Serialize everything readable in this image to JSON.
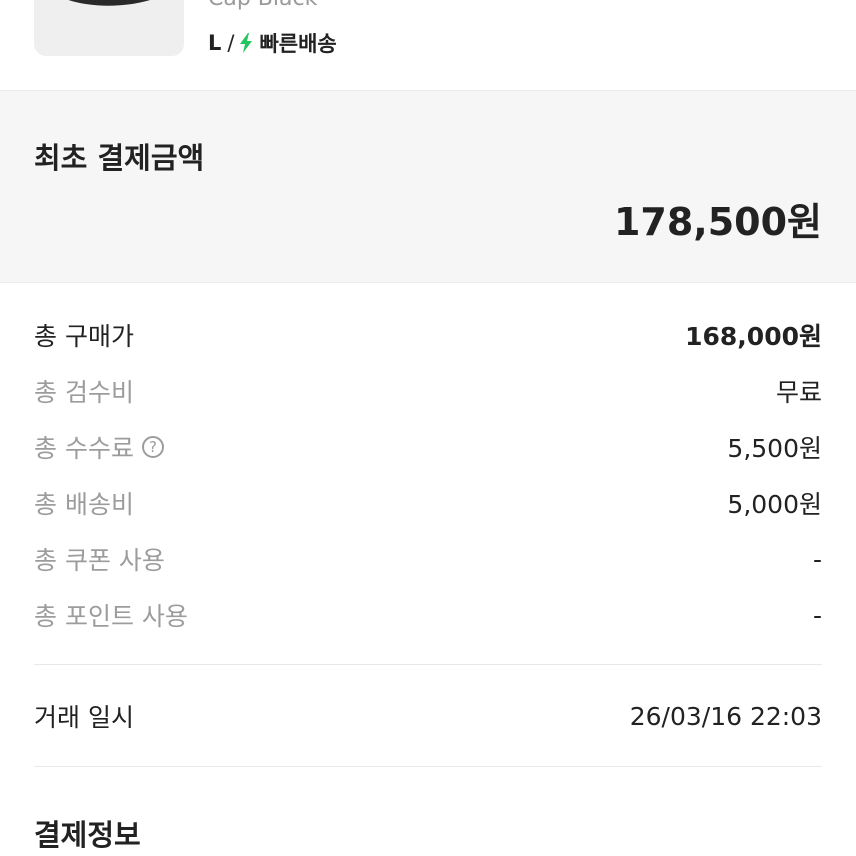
{
  "product": {
    "name": "Cap Black",
    "size": "L",
    "separator": "/",
    "delivery_label": "빠른배송",
    "delivery_color": "#22c55e",
    "bolt_icon": "lightning-bolt-icon"
  },
  "initial_payment": {
    "title": "최초 결제금액",
    "amount": "178,500원"
  },
  "breakdown": [
    {
      "label": "총 구매가",
      "value": "168,000원"
    },
    {
      "label": "총 검수비",
      "value": "무료"
    },
    {
      "label": "총 수수료",
      "value": "5,500원",
      "help_icon": "question-circle-icon",
      "help_glyph": "?"
    },
    {
      "label": "총 배송비",
      "value": "5,000원"
    },
    {
      "label": "총 쿠폰 사용",
      "value": "-"
    },
    {
      "label": "총 포인트 사용",
      "value": "-"
    }
  ],
  "transaction": {
    "label": "거래 일시",
    "value": "26/03/16 22:03"
  },
  "payment_info": {
    "title": "결제정보"
  }
}
